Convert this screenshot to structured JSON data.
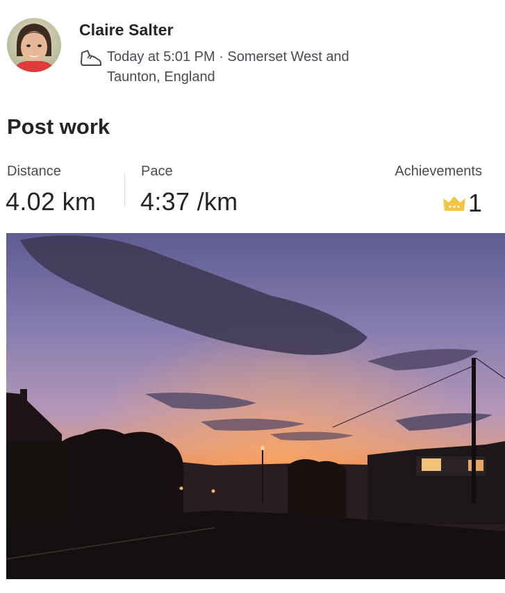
{
  "athlete": {
    "name": "Claire Salter",
    "time": "Today at 5:01 PM · Somerset West and",
    "location_cont": "Taunton, England",
    "avatar_icon": "profile-photo",
    "activity_icon": "shoe-icon"
  },
  "activity": {
    "title": "Post work"
  },
  "stats": {
    "distance_label": "Distance",
    "distance_value": "4.02 km",
    "pace_label": "Pace",
    "pace_value": "4:37 /km",
    "achievements_label": "Achievements",
    "achievements_count": "1",
    "achievements_icon": "crown-icon",
    "achievement_color": "#f4c542"
  },
  "photo": {
    "description_icon": "sunset-street-photo"
  }
}
